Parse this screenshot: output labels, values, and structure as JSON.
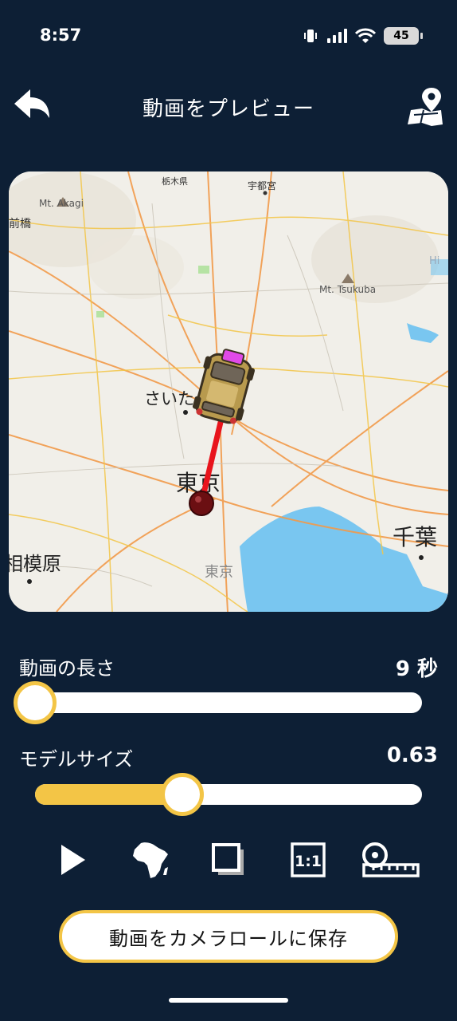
{
  "status_bar": {
    "time": "8:57",
    "battery": "45"
  },
  "header": {
    "title": "動画をプレビュー"
  },
  "map": {
    "labels": {
      "tochigi": "栃木県",
      "utsunomiya": "宇都宮",
      "mt_akagi": "Mt. Akagi",
      "maebashi": "前橋",
      "mt_tsukuba": "Mt. Tsukuba",
      "saitama": "さいた",
      "tokyo": "東京",
      "tokyo_small": "東京",
      "chiba": "千葉",
      "sagamihara": "相模原",
      "hi": "Hi"
    }
  },
  "duration": {
    "label": "動画の長さ",
    "value": "9 秒",
    "level": 0.0
  },
  "model_size": {
    "label": "モデルサイズ",
    "value": "0.63",
    "level": 0.38
  },
  "toolbar": {
    "icons": [
      "play-icon",
      "africa-icon",
      "frame-icon",
      "aspect-ratio-icon",
      "ruler-icon"
    ],
    "aspect_label": "1:1"
  },
  "save_button": {
    "label": "動画をカメラロールに保存"
  },
  "colors": {
    "background": "#0d1f35",
    "accent": "#f3c546",
    "route": "#e8141c",
    "water": "#79c6f0"
  }
}
